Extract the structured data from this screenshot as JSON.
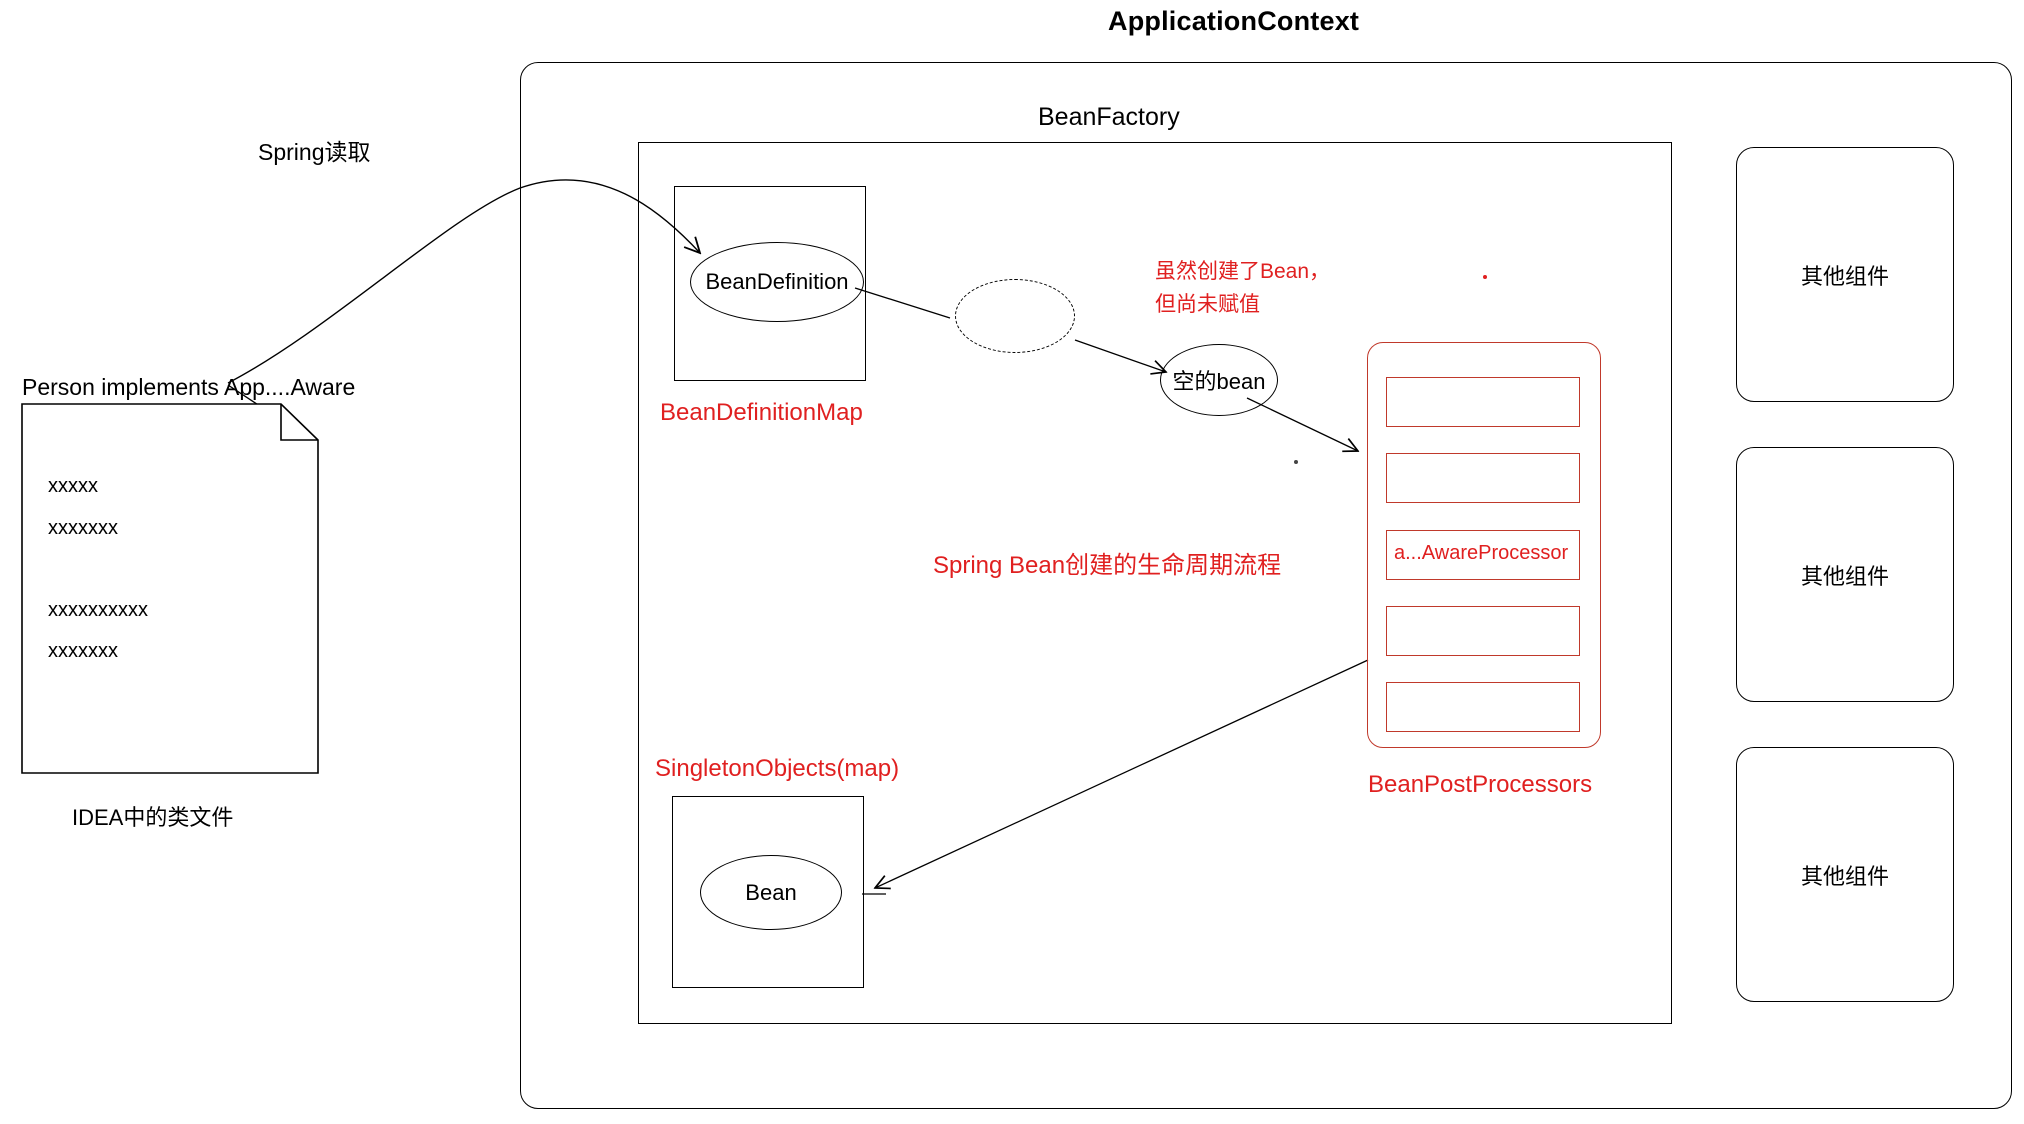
{
  "diagram": {
    "title": "ApplicationContext",
    "subtitle": "BeanFactory",
    "accent_red": "#e02020",
    "line_black": "#000000"
  },
  "left": {
    "flow_label": "Spring读取",
    "class_signature": "Person implements App....Aware",
    "doc_lines": [
      "xxxxx",
      "xxxxxxx",
      "xxxxxxxxxx",
      "xxxxxxx"
    ],
    "doc_caption": "IDEA中的类文件"
  },
  "bean_factory": {
    "bean_definition_map": {
      "node_label": "BeanDefinition",
      "caption": "BeanDefinitionMap"
    },
    "intermediate_node": {
      "label": ""
    },
    "empty_bean": {
      "label": "空的bean",
      "annotation_line1": "虽然创建了Bean，",
      "annotation_line2": "但尚未赋值"
    },
    "lifecycle_label": "Spring Bean创建的生命周期流程",
    "bean_post_processors": {
      "caption": "BeanPostProcessors",
      "items": [
        "",
        "",
        "a...AwareProcessor",
        "",
        ""
      ]
    },
    "singleton_objects": {
      "caption": "SingletonObjects(map)",
      "node_label": "Bean"
    }
  },
  "other_components": [
    {
      "label": "其他组件"
    },
    {
      "label": "其他组件"
    },
    {
      "label": "其他组件"
    }
  ]
}
